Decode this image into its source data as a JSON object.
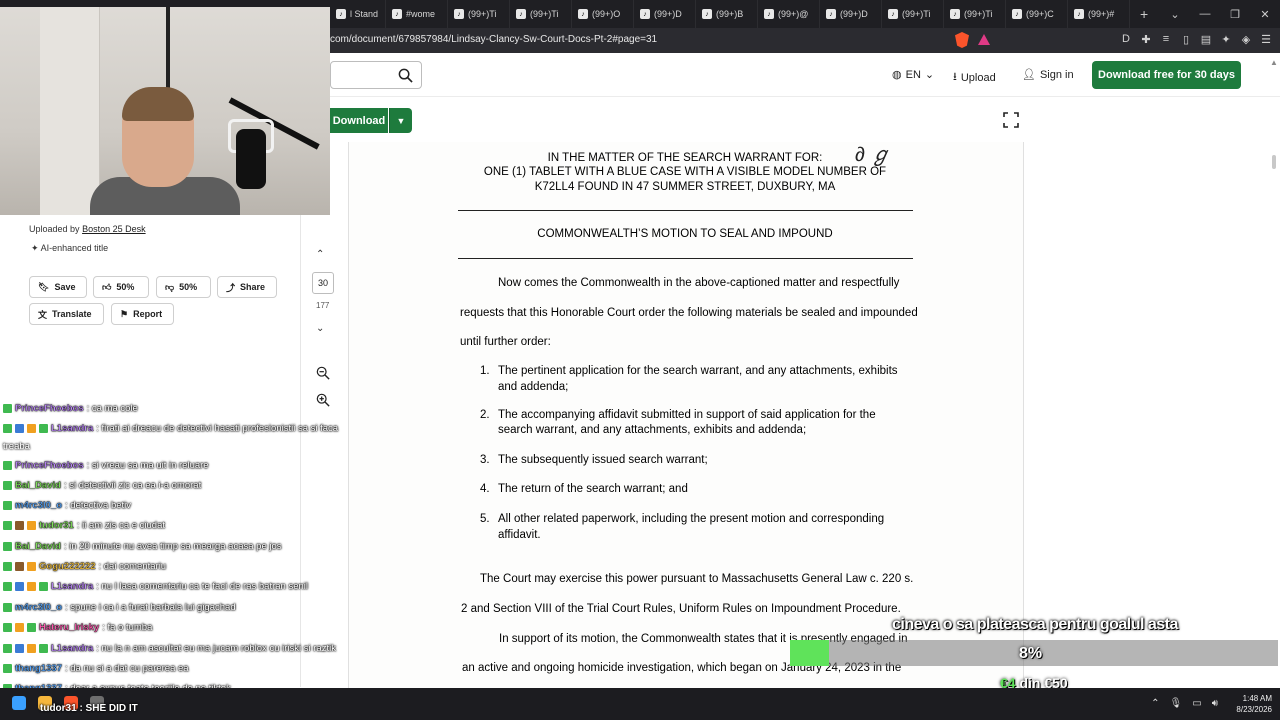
{
  "browser": {
    "tabs": [
      "l Stand",
      "#wome",
      "(99+)Ti",
      "(99+)Ti",
      "(99+)O",
      "(99+)D",
      "(99+)B",
      "(99+)@",
      "(99+)D",
      "(99+)Ti",
      "(99+)Ti",
      "(99+)C",
      "(99+)#"
    ],
    "new_tab": "+",
    "url": "com/document/679857984/Lindsay-Clancy-Sw-Court-Docs-Pt-2#page=31"
  },
  "header": {
    "lang": "EN",
    "upload": "Upload",
    "signin": "Sign in",
    "download_free": "Download free for 30 days"
  },
  "toolbar": {
    "download": "Download"
  },
  "sidebar": {
    "uploaded_prefix": "Uploaded by",
    "uploader": "Boston 25 Desk",
    "ai_title": "AI-enhanced title",
    "save": "Save",
    "like": "50%",
    "dislike": "50%",
    "share": "Share",
    "translate": "Translate",
    "report": "Report"
  },
  "pagenav": {
    "current": "30",
    "total": "177"
  },
  "document": {
    "heading_1": "IN THE MATTER OF THE SEARCH WARRANT FOR:",
    "heading_2": "ONE (1) TABLET WITH A BLUE CASE WITH A VISIBLE MODEL NUMBER OF",
    "heading_3": "K72LL4 FOUND IN 47 SUMMER STREET, DUXBURY, MA",
    "motion_title": "COMMONWEALTH’S MOTION TO SEAL AND IMPOUND",
    "para1_line1": "Now comes the Commonwealth in the above-captioned matter and respectfully",
    "para1_line2": "requests that this Honorable Court order the following materials be sealed and impounded",
    "para1_line3": "until further order:",
    "items": [
      {
        "num": "1.",
        "line1": "The pertinent application for the search warrant, and any attachments, exhibits",
        "line2": "and addenda;"
      },
      {
        "num": "2.",
        "line1": "The accompanying affidavit submitted in support of said application for the",
        "line2": "search warrant, and any attachments, exhibits and addenda;"
      },
      {
        "num": "3.",
        "line1": "The subsequently issued search warrant;",
        "line2": ""
      },
      {
        "num": "4.",
        "line1": "The return of the search warrant; and",
        "line2": ""
      },
      {
        "num": "5.",
        "line1": "All other related paperwork, including the present motion and corresponding",
        "line2": "affidavit."
      }
    ],
    "para2_line1": "The Court may exercise this power pursuant to Massachusetts General Law c. 220 s.",
    "para2_line2": "2 and Section VIII of the Trial Court Rules, Uniform Rules on Impoundment Procedure.",
    "para3_line1": "In support of its motion, the Commonwealth states that it is presently engaged in",
    "para3_line2": "an active and ongoing homicide investigation, which began on January 24, 2023 in the"
  },
  "chat": {
    "wrap": "treaba",
    "lines": [
      {
        "user": "PrinceFhoebos",
        "color": "#c08bff",
        "msg": ": ca ma cole"
      },
      {
        "user": "L1sandra",
        "color": "#c08bff",
        "msg": ": firati ai dreacu de detectivi hasati profesionistii sa si faca"
      },
      {
        "user": "PrinceFhoebos",
        "color": "#c08bff",
        "msg": ": si vreau sa ma uit in reluare"
      },
      {
        "user": "Bai_David",
        "color": "#7fe05a",
        "msg": ": si detectivii zic ca ea i-a omorat"
      },
      {
        "user": "m4rc3l0_o",
        "color": "#5aa9ff",
        "msg": ": detectiva betiv"
      },
      {
        "user": "tudor31",
        "color": "#7fe05a",
        "msg": ": ii am zis ca e ciudat"
      },
      {
        "user": "Bai_David",
        "color": "#7fe05a",
        "msg": ": in 20 minute nu avea timp sa mearga acasa pe jos"
      },
      {
        "user": "Gogu222222",
        "color": "#f0c040",
        "msg": ": dai comentariu"
      },
      {
        "user": "L1sandra",
        "color": "#c08bff",
        "msg": ": nu l lasa comentariu ca te faci de ras batran senil"
      },
      {
        "user": "m4rc3l0_o",
        "color": "#5aa9ff",
        "msg": ": spune i ca i a furat barbaia lui gigachad"
      },
      {
        "user": "Hateru_Irisky",
        "color": "#ff5ab0",
        "msg": ": fa o tumba"
      },
      {
        "user": "L1sandra",
        "color": "#c08bff",
        "msg": ": nu la n am ascultat eu ma jucam roblox cu iriski si raztik"
      },
      {
        "user": "thang1337",
        "color": "#5aa9ff",
        "msg": ": da nu si a dat cu parerea ea"
      },
      {
        "user": "thang1337",
        "color": "#5aa9ff",
        "msg": ": doar a expus toate teoriile de pe tiktok"
      }
    ],
    "last": "tudor31 : SHE DID IT"
  },
  "goal": {
    "text": "cineva o sa plateasca pentru goalul asta",
    "percent": "8%",
    "progress": 0.08,
    "raised": "€4",
    "amount_rest": " din €50"
  },
  "taskbar": {
    "time": "1:48 AM",
    "date": "8/23/2026"
  },
  "colors": {
    "brand_green": "#1e7b3d",
    "goal_green": "#5fe35a"
  }
}
